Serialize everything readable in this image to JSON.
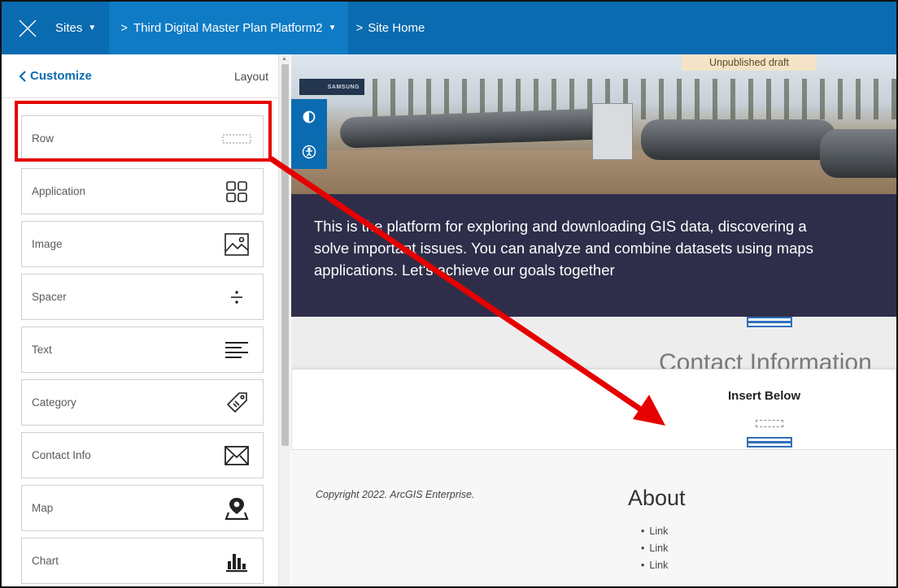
{
  "topbar": {
    "sites_label": "Sites",
    "site_label": "Third Digital Master Plan Platform2",
    "page_label": "Site Home",
    "breadcrumb_sep": ">"
  },
  "sidebar": {
    "back_label": "Customize",
    "layout_label": "Layout",
    "cards": [
      {
        "label": "Row",
        "icon": "row-icon"
      },
      {
        "label": "Application",
        "icon": "application-grid-icon"
      },
      {
        "label": "Image",
        "icon": "image-icon"
      },
      {
        "label": "Spacer",
        "icon": "spacer-icon"
      },
      {
        "label": "Text",
        "icon": "text-icon"
      },
      {
        "label": "Category",
        "icon": "category-tag-icon"
      },
      {
        "label": "Contact Info",
        "icon": "envelope-icon"
      },
      {
        "label": "Map",
        "icon": "map-pin-icon"
      },
      {
        "label": "Chart",
        "icon": "bar-chart-icon"
      }
    ]
  },
  "preview": {
    "draft_label": "Unpublished draft",
    "billboard_text": "SAMSUNG",
    "banner_text": "This is the platform for exploring and downloading GIS data, discovering a\nsolve important issues. You can analyze and combine datasets using maps\napplications. Let's achieve our goals together",
    "contact_title": "Contact Information",
    "insert_label": "Insert Below",
    "footer": {
      "copyright": "Copyright 2022. ArcGIS Enterprise.",
      "about_title": "About",
      "links": [
        "Link",
        "Link",
        "Link"
      ]
    }
  },
  "colors": {
    "topbar": "#0a6bb0",
    "banner": "#2f2e4a",
    "annotation": "#e60000",
    "draft_badge": "#f5e3c7"
  }
}
